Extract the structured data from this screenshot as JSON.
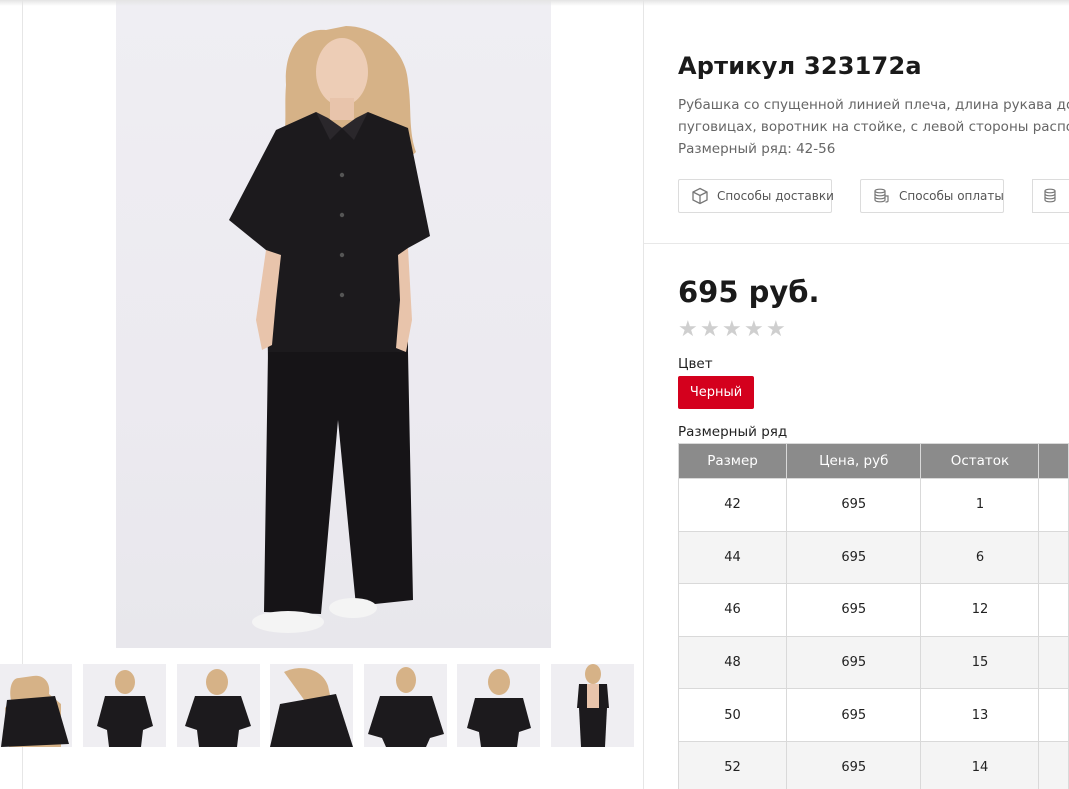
{
  "product": {
    "title": "Артикул 323172а",
    "description_lines": [
      "Рубашка со спущенной линией плеча, длина рукава до ло",
      "пуговицах, воротник на стойке, с левой стороны располож",
      "Размерный ряд: 42-56"
    ],
    "price": "695 руб.",
    "rating_stars": 0,
    "rating_max": 5
  },
  "info_buttons": [
    {
      "label": "Способы доставки",
      "icon": "box-icon"
    },
    {
      "label": "Способы оплаты",
      "icon": "coins-icon"
    }
  ],
  "color": {
    "label": "Цвет",
    "selected": "Черный",
    "accent": "#d4001d"
  },
  "size_table": {
    "label": "Размерный ряд",
    "headers": [
      "Размер",
      "Цена, руб",
      "Остаток",
      ""
    ],
    "rows": [
      [
        "42",
        "695",
        "1"
      ],
      [
        "44",
        "695",
        "6"
      ],
      [
        "46",
        "695",
        "12"
      ],
      [
        "48",
        "695",
        "15"
      ],
      [
        "50",
        "695",
        "13"
      ],
      [
        "52",
        "695",
        "14"
      ]
    ],
    "header_color": "#8b8b8b"
  },
  "gallery": {
    "thumbnail_count": 7
  }
}
